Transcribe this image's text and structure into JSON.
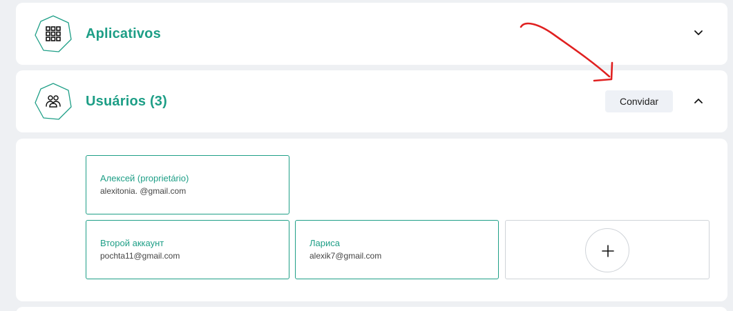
{
  "sections": {
    "apps": {
      "title": "Aplicativos",
      "icon": "apps-grid-icon",
      "expanded": false
    },
    "users": {
      "title": "Usuários (3)",
      "icon": "users-group-icon",
      "expanded": true,
      "invite_label": "Convidar"
    }
  },
  "users": [
    {
      "name": "Алексей (proprietário)",
      "email": "alexitonia. @gmail.com"
    },
    {
      "name": "Второй аккаунт",
      "email": "pochta11@gmail.com"
    },
    {
      "name": "Лариса",
      "email": "alexik7@gmail.com"
    }
  ],
  "add_user": {
    "icon": "plus-icon"
  },
  "colors": {
    "accent": "#1d9e86",
    "annotation": "#e02020",
    "background": "#eef0f3"
  }
}
